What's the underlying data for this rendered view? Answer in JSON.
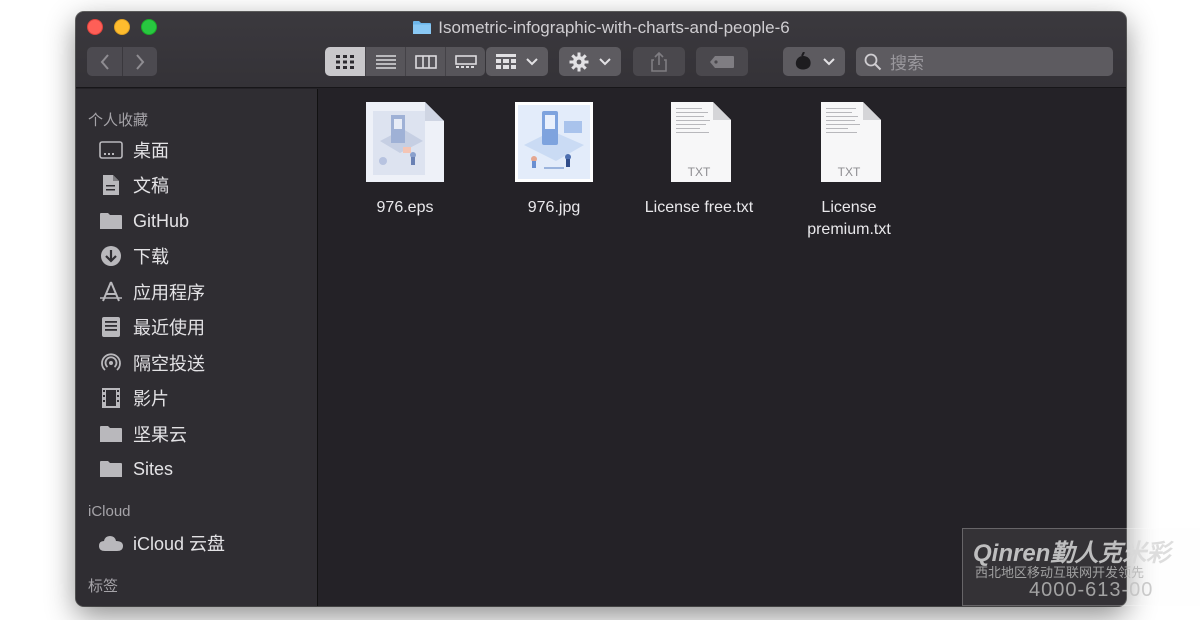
{
  "window": {
    "title": "Isometric-infographic-with-charts-and-people-6"
  },
  "toolbar": {
    "back_icon": "chevron-left-icon",
    "forward_icon": "chevron-right-icon",
    "views": [
      "icon-view",
      "list-view",
      "column-view",
      "gallery-view"
    ],
    "search": {
      "placeholder": "搜索"
    }
  },
  "sidebar": {
    "favorites_header": "个人收藏",
    "items": [
      {
        "label": "桌面",
        "icon": "desktop-icon"
      },
      {
        "label": "文稿",
        "icon": "documents-icon"
      },
      {
        "label": "GitHub",
        "icon": "folder-icon"
      },
      {
        "label": "下载",
        "icon": "download-icon"
      },
      {
        "label": "应用程序",
        "icon": "applications-icon"
      },
      {
        "label": "最近使用",
        "icon": "recents-icon"
      },
      {
        "label": "隔空投送",
        "icon": "airdrop-icon"
      },
      {
        "label": "影片",
        "icon": "movies-icon"
      },
      {
        "label": "坚果云",
        "icon": "folder-icon"
      },
      {
        "label": "Sites",
        "icon": "folder-icon"
      }
    ],
    "icloud_header": "iCloud",
    "icloud_items": [
      {
        "label": "iCloud 云盘",
        "icon": "cloud-icon"
      }
    ],
    "tags_header": "标签"
  },
  "files": [
    {
      "name": "976.eps",
      "kind": "image"
    },
    {
      "name": "976.jpg",
      "kind": "image"
    },
    {
      "name": "License free.txt",
      "kind": "text",
      "badge": "TXT"
    },
    {
      "name": "License premium.txt",
      "kind": "text",
      "badge": "TXT"
    }
  ],
  "watermark": {
    "logo": "Qinren勤人克米彩",
    "line2": "西北地区移动互联网开发领先",
    "line3": "4000-613-00"
  }
}
